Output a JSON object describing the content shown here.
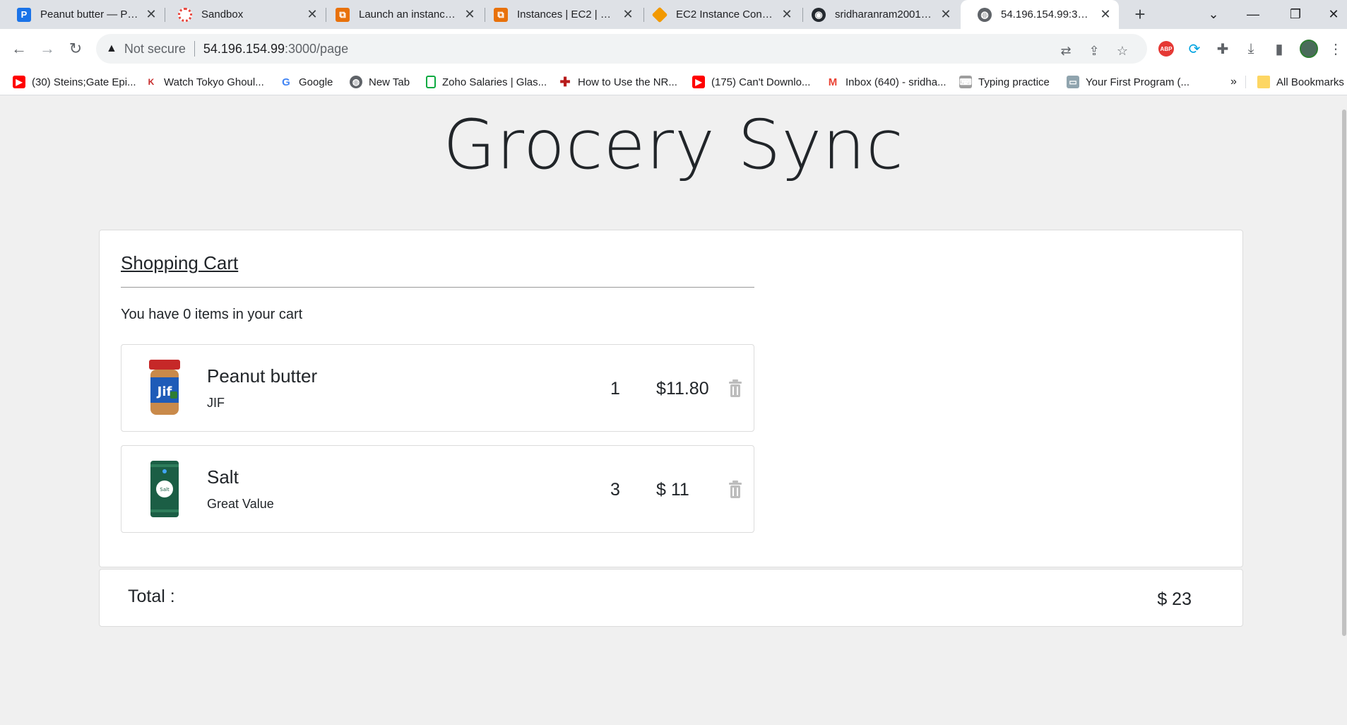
{
  "browser": {
    "tabs": [
      {
        "title": "Peanut butter — Postman",
        "icon": "postman-icon",
        "color": "#1a73e8",
        "active": false
      },
      {
        "title": "Sandbox",
        "icon": "sandbox-icon",
        "color": "#e8453c",
        "active": false
      },
      {
        "title": "Launch an instance | EC2",
        "icon": "aws-icon",
        "color": "#e8710a",
        "active": false
      },
      {
        "title": "Instances | EC2 | us-east-1",
        "icon": "aws-icon",
        "color": "#e8710a",
        "active": false
      },
      {
        "title": "EC2 Instance Connect",
        "icon": "ec2-icon",
        "color": "#f29900",
        "active": false
      },
      {
        "title": "sridharanram2001/Final",
        "icon": "github-icon",
        "color": "#24292f",
        "active": false
      },
      {
        "title": "54.196.154.99:3000/page",
        "icon": "globe-icon",
        "color": "#5f6368",
        "active": true
      }
    ],
    "new_tab": "+",
    "address": {
      "security_label": "Not secure",
      "host": "54.196.154.99",
      "path": ":3000/page"
    },
    "bookmarks": [
      {
        "label": "(30) Steins;Gate Epi...",
        "icon": "youtube-icon",
        "color": "#ff0000"
      },
      {
        "label": "Watch Tokyo Ghoul...",
        "icon": "anime-icon",
        "color": "#c62828"
      },
      {
        "label": "Google",
        "icon": "google-icon",
        "color": "#4285f4"
      },
      {
        "label": "New Tab",
        "icon": "globe-icon",
        "color": "#5f6368"
      },
      {
        "label": "Zoho Salaries | Glas...",
        "icon": "glassdoor-icon",
        "color": "#0caa41"
      },
      {
        "label": "How to Use the NR...",
        "icon": "cross-icon",
        "color": "#b71c1c"
      },
      {
        "label": "(175) Can't Downlo...",
        "icon": "youtube-icon",
        "color": "#ff0000"
      },
      {
        "label": "Inbox (640) - sridha...",
        "icon": "gmail-icon",
        "color": "#ea4335"
      },
      {
        "label": "Typing practice",
        "icon": "typing-icon",
        "color": "#757575"
      },
      {
        "label": "Your First Program (...",
        "icon": "program-icon",
        "color": "#546e7a"
      }
    ],
    "bookmarks_overflow": "»",
    "all_bookmarks": "All Bookmarks"
  },
  "app": {
    "title": "Grocery Sync",
    "cart": {
      "heading": "Shopping Cart",
      "count_text": "You have 0 items in your cart",
      "items": [
        {
          "name": "Peanut butter",
          "brand": "JIF",
          "quantity": "1",
          "price": "$11.80",
          "image": "peanut-butter-jar-image"
        },
        {
          "name": "Salt",
          "brand": "Great Value",
          "quantity": "3",
          "price": "$ 11",
          "image": "salt-canister-image"
        }
      ]
    },
    "total": {
      "label": "Total :",
      "value": "$ 23"
    }
  }
}
